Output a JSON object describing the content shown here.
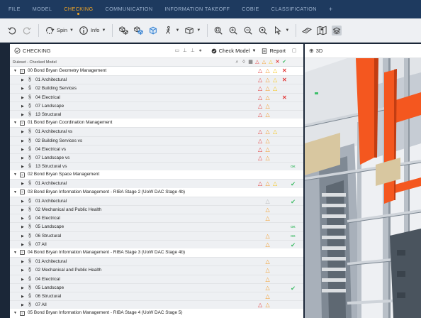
{
  "menu": {
    "items": [
      "FILE",
      "MODEL",
      "CHECKING",
      "COMMUNICATION",
      "INFORMATION TAKEOFF",
      "COBIE",
      "CLASSIFICATION"
    ],
    "active": "CHECKING",
    "plus": "+"
  },
  "toolbar": {
    "spin_label": "Spin",
    "info_label": "Info"
  },
  "panel": {
    "title": "CHECKING",
    "check_model_label": "Check Model",
    "report_label": "Report",
    "ruleset_header": "Ruleset - Checked Model"
  },
  "view3d": {
    "title": "3D"
  },
  "colors": {
    "menubar": "#1e3a5f",
    "accent": "#f6a823",
    "critical": "#e23b3b",
    "moderate": "#f39a25",
    "low": "#f5c518",
    "ok": "#44bd6a",
    "disabled": "#b8b8b8"
  },
  "rows": [
    {
      "type": "group",
      "label": "00 Bond Bryan Geometry Management",
      "marks": [
        "tr-red",
        "tr-orange",
        "tr-yellow",
        "x"
      ]
    },
    {
      "type": "rule",
      "label": "01 Architectural",
      "marks": [
        "tr-red",
        "tr-orange",
        "tr-yellow",
        "x"
      ]
    },
    {
      "type": "rule",
      "label": "02 Building Services",
      "marks": [
        "tr-red",
        "tr-orange",
        "tr-yellow"
      ]
    },
    {
      "type": "rule",
      "label": "04 Electrical",
      "marks": [
        "tr-red",
        "tr-orange",
        "",
        "x"
      ]
    },
    {
      "type": "rule",
      "label": "07 Landscape",
      "marks": [
        "tr-red",
        "tr-orange"
      ]
    },
    {
      "type": "rule",
      "label": "13 Structural",
      "marks": [
        "tr-red",
        "tr-orange"
      ]
    },
    {
      "type": "group",
      "label": "01 Bond Bryan Coordination Management",
      "marks": []
    },
    {
      "type": "rule",
      "label": "01 Architectural vs",
      "marks": [
        "tr-red",
        "tr-orange",
        "tr-yellow"
      ]
    },
    {
      "type": "rule",
      "label": "02 Building Services vs",
      "marks": [
        "tr-red",
        "tr-orange"
      ]
    },
    {
      "type": "rule",
      "label": "04 Electrical vs",
      "marks": [
        "tr-red",
        "tr-orange"
      ]
    },
    {
      "type": "rule",
      "label": "07 Landscape vs",
      "marks": [
        "tr-red",
        "tr-orange"
      ]
    },
    {
      "type": "rule",
      "label": "13 Structural vs",
      "marks": [
        "",
        "",
        "",
        "",
        "ok"
      ]
    },
    {
      "type": "group",
      "label": "02 Bond Bryan Space Management",
      "marks": []
    },
    {
      "type": "rule",
      "label": "01 Architectural",
      "marks": [
        "tr-red",
        "tr-orange",
        "tr-yellow",
        "",
        "check"
      ]
    },
    {
      "type": "group",
      "label": "03 Bond Bryan Information Management - RIBA Stage 2 (UoW DAC Stage 4b)",
      "marks": []
    },
    {
      "type": "rule",
      "label": "01 Architectural",
      "marks": [
        "",
        "tr-grey",
        "",
        "",
        "check"
      ]
    },
    {
      "type": "rule",
      "label": "02 Mechanical and Public Health",
      "marks": [
        "",
        "tr-orange"
      ]
    },
    {
      "type": "rule",
      "label": "04 Electrical",
      "marks": [
        "",
        "tr-orange"
      ]
    },
    {
      "type": "rule",
      "label": "05 Landscape",
      "marks": [
        "",
        "",
        "",
        "",
        "ok"
      ]
    },
    {
      "type": "rule",
      "label": "06 Structural",
      "marks": [
        "",
        "tr-orange",
        "",
        "",
        "ok"
      ]
    },
    {
      "type": "rule",
      "label": "07 All",
      "marks": [
        "",
        "tr-orange",
        "",
        "",
        "check"
      ]
    },
    {
      "type": "group",
      "label": "04 Bond Bryan Information Management - RIBA Stage 3 (UoW DAC Stage 4b)",
      "marks": []
    },
    {
      "type": "rule",
      "label": "01 Architectural",
      "marks": [
        "",
        "tr-orange"
      ]
    },
    {
      "type": "rule",
      "label": "02 Mechanical and Public Health",
      "marks": [
        "",
        "tr-orange"
      ]
    },
    {
      "type": "rule",
      "label": "04 Electrical",
      "marks": [
        "",
        "tr-orange"
      ]
    },
    {
      "type": "rule",
      "label": "05 Landscape",
      "marks": [
        "",
        "tr-orange",
        "",
        "",
        "check"
      ]
    },
    {
      "type": "rule",
      "label": "06 Structural",
      "marks": [
        "",
        "tr-orange"
      ]
    },
    {
      "type": "rule",
      "label": "07 All",
      "marks": [
        "tr-red",
        "tr-orange"
      ]
    },
    {
      "type": "group",
      "label": "05 Bond Bryan Information Management - RIBA Stage 4 (UoW DAC Stage 5)",
      "marks": []
    }
  ]
}
